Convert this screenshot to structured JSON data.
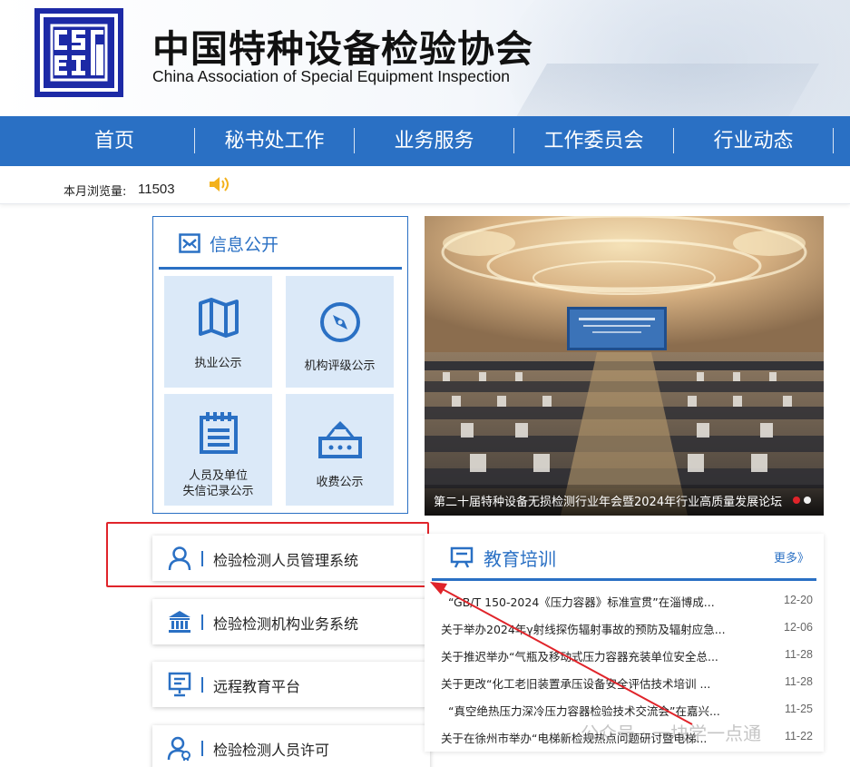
{
  "header": {
    "title": "中国特种设备检验协会",
    "subtitle": "China Association of Special Equipment Inspection",
    "logo_text": "CSEI"
  },
  "nav": {
    "items": [
      {
        "label": "首页"
      },
      {
        "label": "秘书处工作"
      },
      {
        "label": "业务服务"
      },
      {
        "label": "工作委员会"
      },
      {
        "label": "行业动态"
      }
    ]
  },
  "stats": {
    "label": "本月浏览量:",
    "value": "11503",
    "icon": "speaker-icon"
  },
  "info_panel": {
    "title": "信息公开",
    "tiles": [
      {
        "label": "执业公示",
        "icon": "map-icon"
      },
      {
        "label": "机构评级公示",
        "icon": "compass-icon"
      },
      {
        "label": "人员及单位\n失信记录公示",
        "label_line1": "人员及单位",
        "label_line2": "失信记录公示",
        "icon": "notepad-icon"
      },
      {
        "label": "收费公示",
        "icon": "toll-icon"
      }
    ]
  },
  "banner": {
    "caption": "第二十届特种设备无损检测行业年会暨2024年行业高质量发展论坛",
    "active_dot_color": "#e0242a"
  },
  "systems": [
    {
      "label": "检验检测人员管理系统",
      "icon": "person-icon"
    },
    {
      "label": "检验检测机构业务系统",
      "icon": "bank-icon"
    },
    {
      "label": "远程教育平台",
      "icon": "presentation-icon"
    },
    {
      "label": "检验检测人员许可",
      "icon": "person-badge-icon"
    }
  ],
  "education": {
    "title": "教育培训",
    "more": "更多》",
    "items": [
      {
        "title": "“GB/T 150-2024《压力容器》标准宣贯”在淄博成...",
        "date": "12-20"
      },
      {
        "title": "关于举办2024年γ射线探伤辐射事故的预防及辐射应急...",
        "date": "12-06"
      },
      {
        "title": "关于推迟举办“气瓶及移动式压力容器充装单位安全总...",
        "date": "11-28"
      },
      {
        "title": "关于更改“化工老旧装置承压设备安全评估技术培训 ...",
        "date": "11-28"
      },
      {
        "title": "“真空绝热压力深冷压力容器检验技术交流会”在嘉兴...",
        "date": "11-25"
      },
      {
        "title": "关于在徐州市举办“电梯新检规热点问题研讨暨电梯...",
        "date": "11-22"
      }
    ]
  },
  "watermark": "公众号 · 一块学一点通",
  "colors": {
    "primary": "#2a70c4",
    "logo": "#1d2aa6",
    "highlight": "#e0242a",
    "tile_bg": "#dbe9f8"
  }
}
